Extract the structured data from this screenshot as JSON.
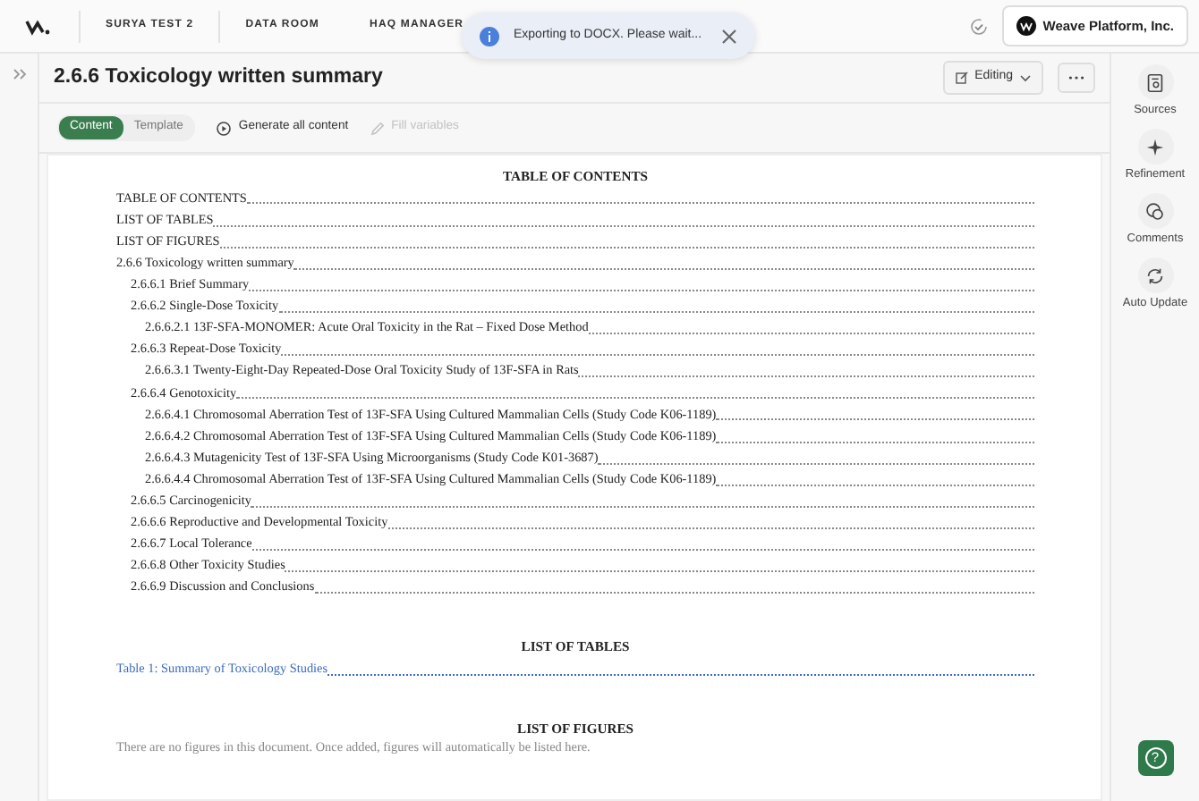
{
  "topbar": {
    "nav": [
      "SURYA TEST 2",
      "DATA ROOM",
      "HAQ MANAGER"
    ],
    "org": "Weave Platform, Inc."
  },
  "toast": {
    "message": "Exporting to DOCX. Please wait..."
  },
  "header": {
    "title": "2.6.6 Toxicology written summary",
    "mode": "Editing"
  },
  "toolbar": {
    "view_toggle": [
      {
        "label": "Content",
        "selected": true
      },
      {
        "label": "Template",
        "selected": false
      }
    ],
    "actions": [
      {
        "label": "Generate all content",
        "disabled": false
      },
      {
        "label": "Fill variables",
        "disabled": true
      }
    ]
  },
  "document": {
    "toc_heading": "TABLE OF CONTENTS",
    "toc": [
      {
        "text": "TABLE OF CONTENTS"
      },
      {
        "text": "LIST OF TABLES"
      },
      {
        "text": "LIST OF FIGURES"
      },
      {
        "text": "2.6.6 Toxicology written summary",
        "children": [
          {
            "text": "2.6.6.1 Brief Summary"
          },
          {
            "text": "2.6.6.2 Single-Dose Toxicity",
            "children": [
              {
                "text": "2.6.6.2.1 13F-SFA-MONOMER: Acute Oral Toxicity in the Rat – Fixed Dose Method"
              }
            ]
          },
          {
            "text": "2.6.6.3 Repeat-Dose Toxicity",
            "children": [
              {
                "text": "2.6.6.3.1 Twenty-Eight-Day Repeated-Dose Oral Toxicity Study of 13F-SFA in Rats"
              }
            ]
          },
          {
            "text": "2.6.6.4 Genotoxicity",
            "children": [
              {
                "text": "2.6.6.4.1 Chromosomal Aberration Test of 13F-SFA Using Cultured Mammalian Cells (Study Code K06-1189)"
              },
              {
                "text": "2.6.6.4.2 Chromosomal Aberration Test of 13F-SFA Using Cultured Mammalian Cells (Study Code K06-1189)"
              },
              {
                "text": "2.6.6.4.3 Mutagenicity Test of 13F-SFA Using Microorganisms (Study Code K01-3687)"
              },
              {
                "text": "2.6.6.4.4 Chromosomal Aberration Test of 13F-SFA Using Cultured Mammalian Cells (Study Code K06-1189)"
              }
            ]
          },
          {
            "text": "2.6.6.5 Carcinogenicity"
          },
          {
            "text": "2.6.6.6 Reproductive and Developmental Toxicity"
          },
          {
            "text": "2.6.6.7 Local Tolerance"
          },
          {
            "text": "2.6.6.8 Other Toxicity Studies"
          },
          {
            "text": "2.6.6.9 Discussion and Conclusions"
          }
        ]
      }
    ],
    "tables_heading": "LIST OF TABLES",
    "tables": [
      "Table 1: Summary of Toxicology Studies"
    ],
    "figures_heading": "LIST OF FIGURES",
    "figures_note": "There are no figures in this document. Once added, figures will automatically be listed here."
  },
  "right_rail": [
    {
      "label": "Sources",
      "kind": "sources"
    },
    {
      "label": "Refinement",
      "kind": "refinement"
    },
    {
      "label": "Comments",
      "kind": "comments"
    },
    {
      "label": "Auto Update",
      "kind": "update"
    }
  ],
  "help": {
    "icon": "?"
  }
}
